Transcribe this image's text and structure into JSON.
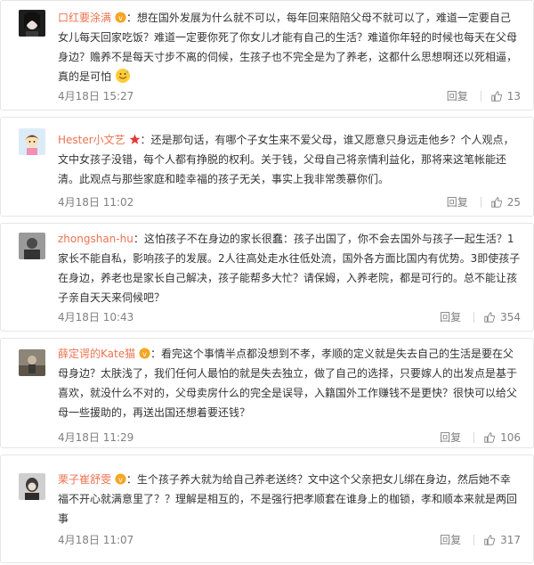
{
  "comments": [
    {
      "user": "口红要涂满",
      "text": "想在国外发展为什么就不可以，每年回来陪陪父母不就可以了，难道一定要自己女儿每天回家吃饭？难道一定要你死了你女儿才能有自己的生活？难道你年轻的时候也每天在父母身边？赡养不是每天寸步不离的伺候，生孩子也不完全是为了养老，这都什么思想啊还以死相逼，真的是可怕",
      "emoji": "sweat-smile-emoji",
      "time": "4月18日 15:27",
      "reply": "回复",
      "likes": "13",
      "avatar_color": "#2b2b2b"
    },
    {
      "user": "Hester小文艺",
      "text": "还是那句话，有哪个子女生来不爱父母，谁又愿意只身远走他乡？个人观点，文中女孩子没错，每个人都有挣脱的权利。关于钱，父母自己将亲情利益化，那将来这笔帐能还清。此观点与那些家庭和睦幸福的孩子无关，事实上我非常羡慕你们。",
      "time": "4月18日 11:02",
      "reply": "回复",
      "likes": "25",
      "avatar_color": "#cfe3f2"
    },
    {
      "user": "zhongshan-hu",
      "text": "这怕孩子不在身边的家长很蠢：孩子出国了，你不会去国外与孩子一起生活？1家长不能自私，影响孩子的发展。2人往高处走水往低处流，国外各方面比国内有优势。3即使孩子在身边，养老也是家长自己解决，孩子能帮多大忙？请保姆，入养老院，都是可行的。总不能让孩子亲自天天来伺候吧？",
      "time": "4月18日 10:43",
      "reply": "回复",
      "likes": "354",
      "avatar_color": "#5a5a5a"
    },
    {
      "user": "薛定谔的Kate猫",
      "text": "看完这个事情半点都没想到不孝，孝顺的定义就是失去自己的生活是要在父母身边？太肤浅了，我们任何人最怕的就是失去独立，做了自己的选择，只要嫁人的出发点是基于喜欢，就没什么不对的，父母卖房什么的完全是误导，入籍国外工作赚钱不是更快？很快可以给父母一些援助的，再送出国还想着要还钱？",
      "time": "4月18日 11:29",
      "reply": "回复",
      "likes": "106",
      "avatar_color": "#7c7468"
    },
    {
      "user": "栗子崔舒雯",
      "text": "生个孩子养大就为给自己养老送终？文中这个父亲把女儿绑在身边，然后她不幸福不开心就满意里了？？理解是相互的，不是强行把孝顺套在谁身上的枷锁，孝和顺本来就是两回事",
      "time": "4月18日 11:07",
      "reply": "回复",
      "likes": "317",
      "avatar_color": "#3e3a36"
    }
  ],
  "colors": {
    "username": "#eb7350",
    "meta": "#808080"
  }
}
